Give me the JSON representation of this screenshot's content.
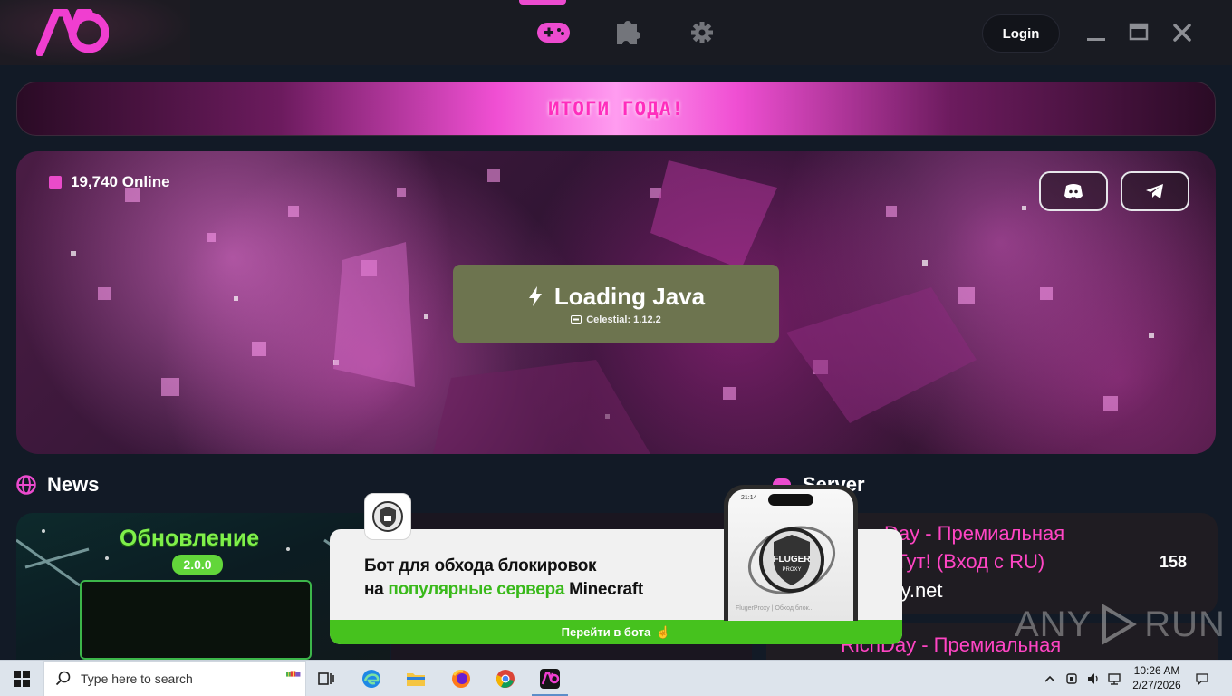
{
  "app": {
    "nav": [
      {
        "icon": "gamepad-icon",
        "active": true
      },
      {
        "icon": "puzzle-icon",
        "active": false
      },
      {
        "icon": "gear-icon",
        "active": false
      }
    ],
    "login_label": "Login"
  },
  "banner": {
    "text": "ИТОГИ ГОДА!"
  },
  "hero": {
    "online_text": "19,740 Online",
    "social": [
      "discord-icon",
      "telegram-icon"
    ],
    "play": {
      "title": "Loading Java",
      "subtitle": "Celestial: 1.12.2"
    }
  },
  "news": {
    "heading": "News",
    "card": {
      "title": "Обновление",
      "version": "2.0.0"
    }
  },
  "server": {
    "heading": "Server",
    "items": [
      {
        "line1": "Day - Премиальная",
        "line2": "ия Тут! (Вход с RU)",
        "line3": "day.net",
        "count": "158"
      },
      {
        "line1": "RichDay - Премиальная"
      }
    ]
  },
  "ad": {
    "line1": "Бот для обхода блокировок",
    "line2_pre": "на ",
    "line2_green": "популярные сервера",
    "line2_post": " Minecraft",
    "cta": "Перейти в бота",
    "phone_time": "21:14",
    "phone_caption": "FlugerProxy | Обход блок..."
  },
  "watermark": {
    "left": "ANY",
    "right": "RUN"
  },
  "taskbar": {
    "search_placeholder": "Type here to search",
    "time": "10:26 AM",
    "date": "2/27/2026",
    "apps": [
      "task-view-icon",
      "edge-icon",
      "file-explorer-icon",
      "firefox-icon",
      "chrome-icon",
      "launcher-app-icon"
    ]
  },
  "colors": {
    "accent": "#ec4bcf",
    "play_button": "#6d744f",
    "server_name": "#ff45c4",
    "ad_green": "#46c21e"
  }
}
